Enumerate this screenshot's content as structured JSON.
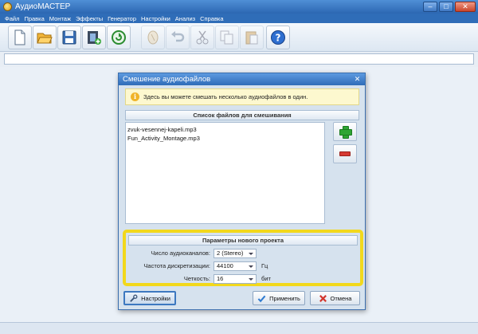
{
  "window": {
    "title": "АудиоМАСТЕР"
  },
  "menu": [
    "Файл",
    "Правка",
    "Монтаж",
    "Эффекты",
    "Генератор",
    "Настройки",
    "Анализ",
    "Справка"
  ],
  "toolbar_icons": [
    "new-file-icon",
    "open-folder-icon",
    "save-icon",
    "add-video-icon",
    "record-icon",
    "mix-icon",
    "undo-icon",
    "cut-icon",
    "copy-icon",
    "paste-icon",
    "help-icon"
  ],
  "dialog": {
    "title": "Смешение аудиофайлов",
    "hint": "Здесь вы можете смешать несколько аудиофайлов в один.",
    "files_header": "Список файлов для смешивания",
    "files": [
      "zvuk-vesennej-kapeli.mp3",
      "Fun_Activity_Montage.mp3"
    ],
    "params_header": "Параметры нового проекта",
    "params": [
      {
        "label": "Число аудиоканалов:",
        "value": "2 (Stereo)",
        "unit": ""
      },
      {
        "label": "Частота дискретизации:",
        "value": "44100",
        "unit": "Гц"
      },
      {
        "label": "Четкость:",
        "value": "16",
        "unit": "бит"
      }
    ],
    "buttons": {
      "settings": "Настройки",
      "apply": "Применить",
      "cancel": "Отмена"
    }
  },
  "colors": {
    "titlebar": "#2f6cb8",
    "highlight": "#f2d81c",
    "add": "#2ea532",
    "remove": "#d63a32"
  }
}
